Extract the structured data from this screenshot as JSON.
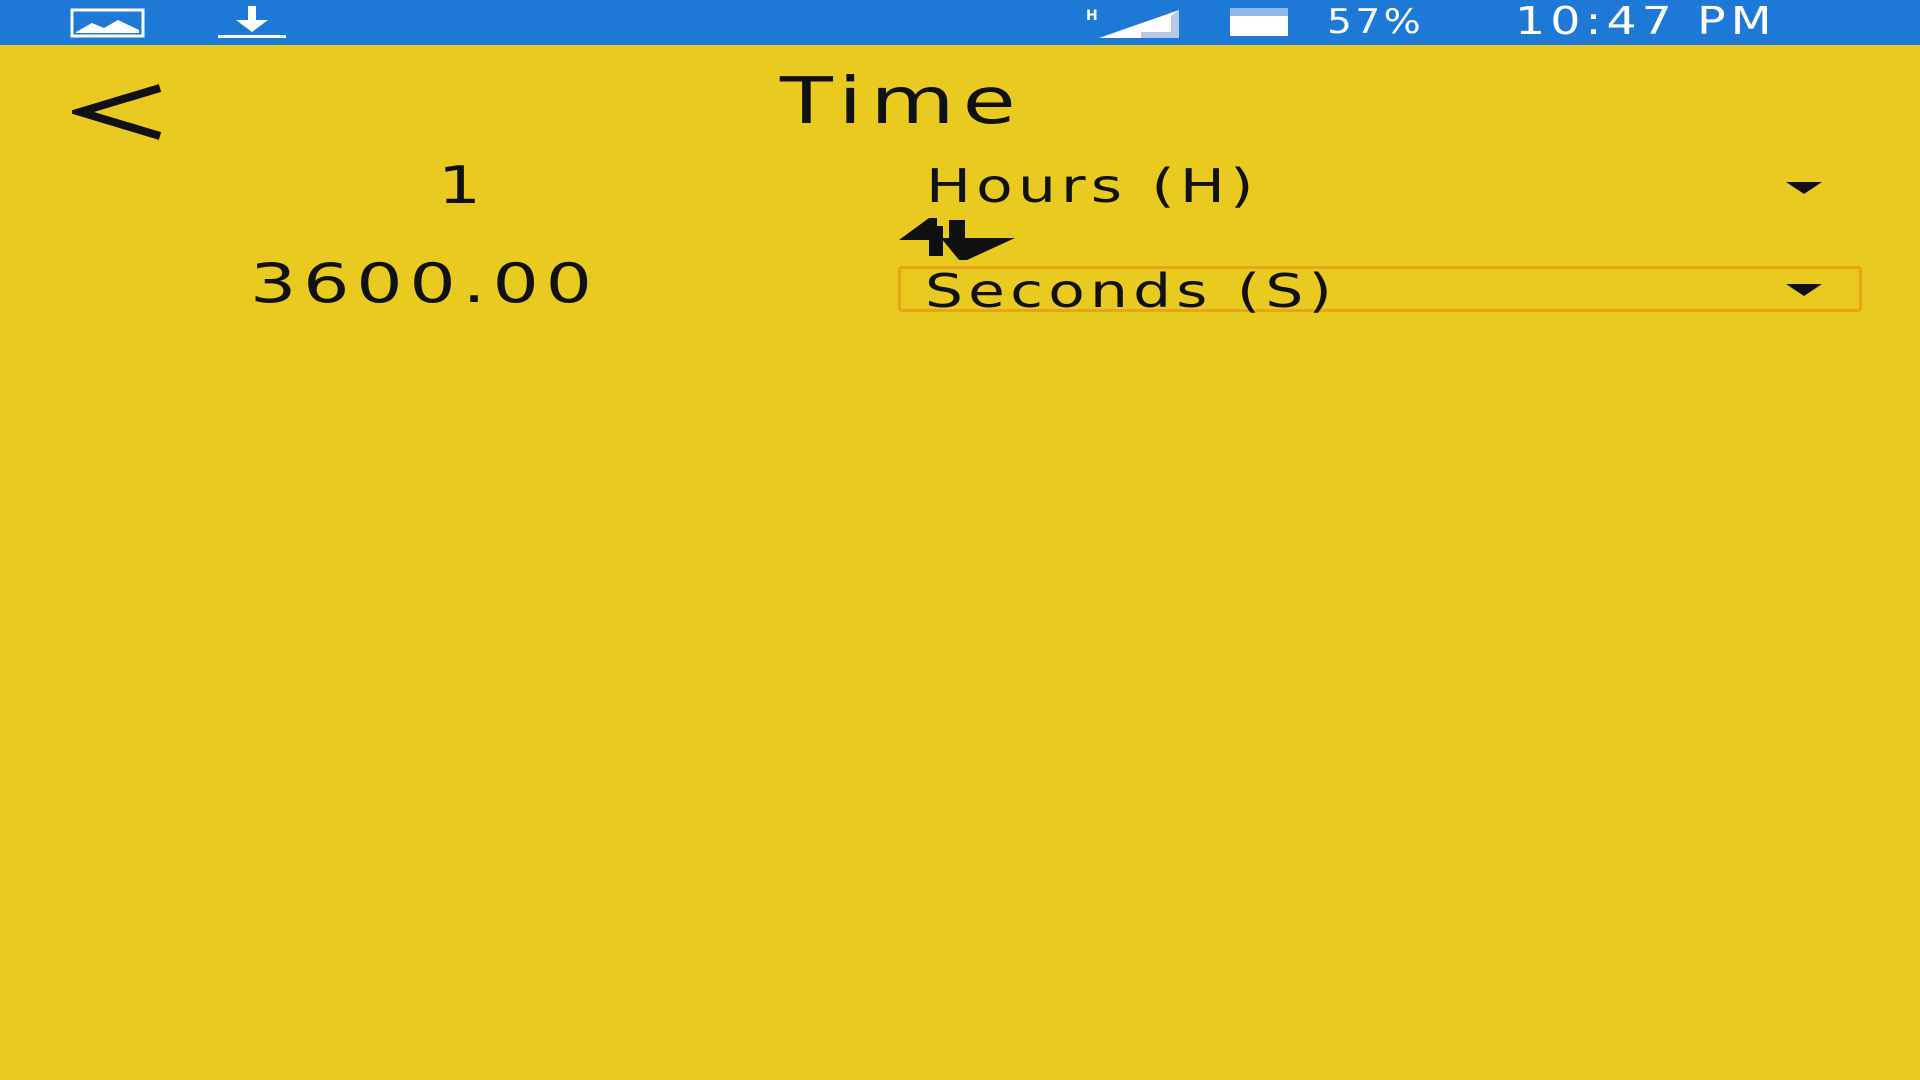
{
  "status_bar": {
    "battery_percent": "57%",
    "time": "10:47 PM",
    "icons": [
      "gallery-icon",
      "download-icon",
      "signal-h-icon",
      "battery-icon"
    ]
  },
  "header": {
    "title": "Time",
    "back_icon": "back-arrow-icon"
  },
  "converter": {
    "from_value": "1",
    "from_unit": "Hours (H)",
    "to_value": "3600.00",
    "to_unit": "Seconds (S)",
    "swap_icon": "swap-arrows-icon"
  },
  "colors": {
    "background": "#e8ca20",
    "status_bar": "#1e78d6",
    "focus_border": "#e8a516"
  }
}
